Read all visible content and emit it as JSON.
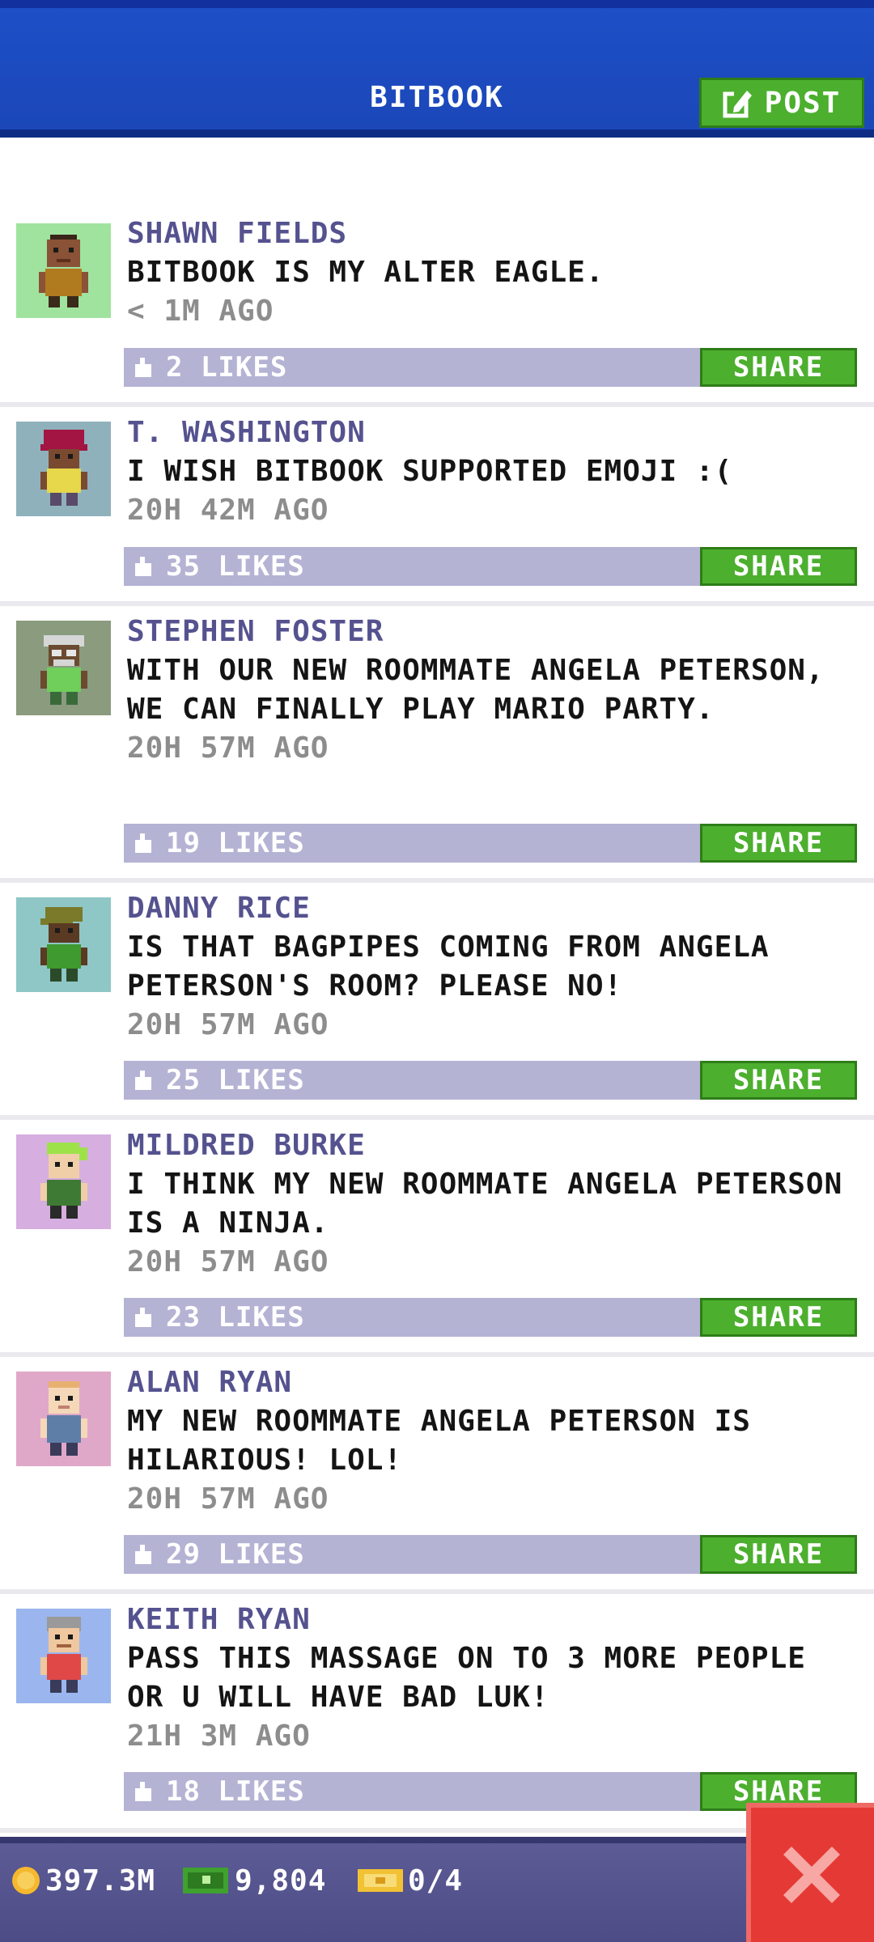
{
  "header": {
    "title": "BITBOOK",
    "post_label": "POST"
  },
  "posts": [
    {
      "author": "SHAWN FIELDS",
      "message": "BITBOOK IS MY ALTER EAGLE.",
      "time": "< 1M AGO",
      "likes": "2 LIKES",
      "share_label": "SHARE"
    },
    {
      "author": "T. WASHINGTON",
      "message": "I WISH BITBOOK SUPPORTED EMOJI :(",
      "time": "20H 42M AGO",
      "likes": "35 LIKES",
      "share_label": "SHARE"
    },
    {
      "author": "STEPHEN FOSTER",
      "message": "WITH OUR NEW ROOMMATE ANGELA PETERSON, WE CAN FINALLY PLAY MARIO PARTY.",
      "time": "20H 57M AGO",
      "likes": "19 LIKES",
      "share_label": "SHARE"
    },
    {
      "author": "DANNY RICE",
      "message": "IS THAT BAGPIPES COMING FROM ANGELA PETERSON'S ROOM? PLEASE NO!",
      "time": "20H 57M AGO",
      "likes": "25 LIKES",
      "share_label": "SHARE"
    },
    {
      "author": "MILDRED BURKE",
      "message": "I THINK MY NEW ROOMMATE ANGELA PETERSON IS A NINJA.",
      "time": "20H 57M AGO",
      "likes": "23 LIKES",
      "share_label": "SHARE"
    },
    {
      "author": "ALAN RYAN",
      "message": "MY NEW ROOMMATE ANGELA PETERSON IS HILARIOUS! LOL!",
      "time": "20H 57M AGO",
      "likes": "29 LIKES",
      "share_label": "SHARE"
    },
    {
      "author": "KEITH RYAN",
      "message": "PASS THIS MASSAGE ON TO 3 MORE PEOPLE OR U WILL HAVE BAD LUK!",
      "time": "21H 3M AGO",
      "likes": "18 LIKES",
      "share_label": "SHARE"
    }
  ],
  "status": {
    "coins": "397.3M",
    "bux": "9,804",
    "tickets": "0/4"
  },
  "colors": {
    "header_blue": "#1d4fc7",
    "accent_green": "#4caf2e",
    "like_bar": "#b4b3d4",
    "author_purple": "#55528f",
    "close_red": "#e53935"
  },
  "icons": {
    "post": "edit-icon",
    "like": "thumbs-up-icon",
    "coins": "coin-icon",
    "bux": "bux-icon",
    "tickets": "ticket-icon",
    "close": "close-icon"
  }
}
